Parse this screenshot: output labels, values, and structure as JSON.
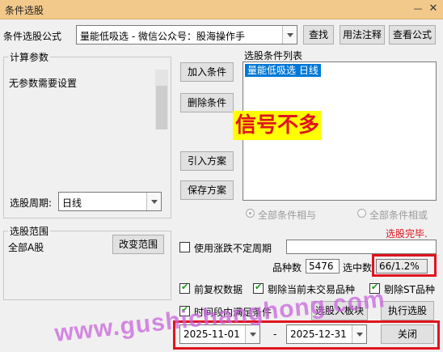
{
  "window": {
    "title": "条件选股"
  },
  "formula_row": {
    "label": "条件选股公式",
    "formula_value": "量能低吸选 - 微信公众号：股海操作手",
    "find_button": "查找",
    "usage_button": "用法注释",
    "view_formula_button": "查看公式"
  },
  "params_group": {
    "label": "计算参数",
    "no_params_text": "无参数需要设置",
    "period_label": "选股周期:",
    "period_value": "日线"
  },
  "conditions_group": {
    "label": "选股条件列表",
    "items": [
      "量能低吸选  日线"
    ]
  },
  "buttons": {
    "add_condition": "加入条件",
    "remove_condition": "删除条件",
    "import_scheme": "引入方案",
    "save_scheme": "保存方案",
    "change_scope": "改变范围",
    "select_to_board": "选股入板块",
    "execute": "执行选股",
    "close": "关闭"
  },
  "logic": {
    "and_label": "全部条件相与",
    "or_label": "全部条件相或",
    "and_selected": true
  },
  "annotation_text": "信号不多",
  "status": {
    "done": "选股完毕.",
    "count_label": "品种数",
    "count_value": "5476",
    "selected_label": "选中数",
    "selected_value": "66/1.2%"
  },
  "scope_group": {
    "label": "选股范围",
    "scope_value": "全部A股"
  },
  "options": {
    "variable_period": {
      "label": "使用涨跌不定周期",
      "checked": false
    },
    "pre_adjust": {
      "label": "前复权数据",
      "checked": true
    },
    "exclude_untraded": {
      "label": "剔除当前未交易品种",
      "checked": true
    },
    "exclude_st": {
      "label": "剔除ST品种",
      "checked": true
    },
    "time_range": {
      "label": "时间段内满足条件",
      "checked": true
    }
  },
  "date_range": {
    "start": "2025-11-01",
    "separator": "-",
    "end": "2025-12-31"
  },
  "watermark": "www.gushichanghong.com",
  "colors": {
    "titlebar": "#f2c98b",
    "selection": "#0078d7",
    "highlight_red": "#e0141e",
    "annotation_text": "#e0141e",
    "annotation_bg": "#ffff00",
    "done_text": "#e0141e"
  }
}
